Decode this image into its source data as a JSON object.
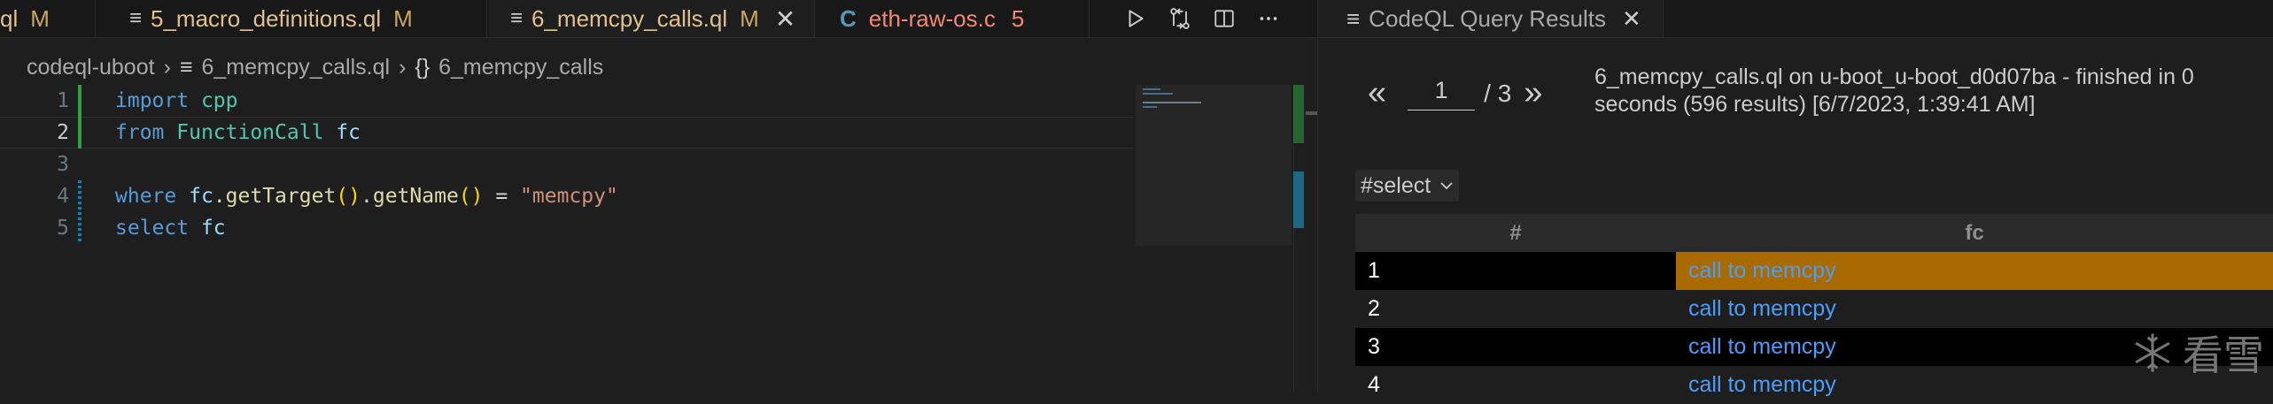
{
  "tabs": [
    {
      "icon": "",
      "label": "ql",
      "status": "M"
    },
    {
      "icon": "file-lines-icon",
      "label": "5_macro_definitions.ql",
      "status": "M"
    },
    {
      "icon": "file-lines-icon",
      "label": "6_memcpy_calls.ql",
      "status": "M",
      "close": "✕"
    },
    {
      "icon": "c-lang-icon",
      "icon_text": "C",
      "label": "eth-raw-os.c",
      "status": "5"
    }
  ],
  "breadcrumb": {
    "root": "codeql-uboot",
    "file": "6_memcpy_calls.ql",
    "symbol_icon": "{}",
    "symbol": "6_memcpy_calls",
    "sep": "›"
  },
  "editor": {
    "line_numbers": [
      "1",
      "2",
      "3",
      "4",
      "5"
    ],
    "l1": {
      "kw": "import",
      "mod": "cpp"
    },
    "l2": {
      "kw": "from",
      "type": "FunctionCall",
      "var": "fc"
    },
    "l4": {
      "kw": "where",
      "var": "fc",
      "dot1": ".",
      "m1": "getTarget",
      "p": "()",
      "dot2": ".",
      "m2": "getName",
      "p2": "()",
      "eq": " = ",
      "str": "\"memcpy\""
    },
    "l5": {
      "kw": "select",
      "var": "fc"
    }
  },
  "results": {
    "tab_label": "CodeQL Query Results",
    "close": "✕",
    "prev": "«",
    "next": "»",
    "page": "1",
    "page_total": "/ 3",
    "summary": "6_memcpy_calls.ql on u-boot_u-boot_d0d07ba - finished in 0 seconds (596 results) [6/7/2023, 1:39:41 AM]",
    "result_set": "#select",
    "columns": [
      "#",
      "fc"
    ],
    "rows": [
      {
        "n": "1",
        "v": "call to memcpy"
      },
      {
        "n": "2",
        "v": "call to memcpy"
      },
      {
        "n": "3",
        "v": "call to memcpy"
      },
      {
        "n": "4",
        "v": "call to memcpy"
      }
    ]
  },
  "watermark": {
    "text": "看雪"
  },
  "colors": {
    "accent_selected_row": "#a96a00",
    "link": "#4a9df8",
    "modified_tab": "#e2c08d",
    "error_tab": "#f48771"
  }
}
